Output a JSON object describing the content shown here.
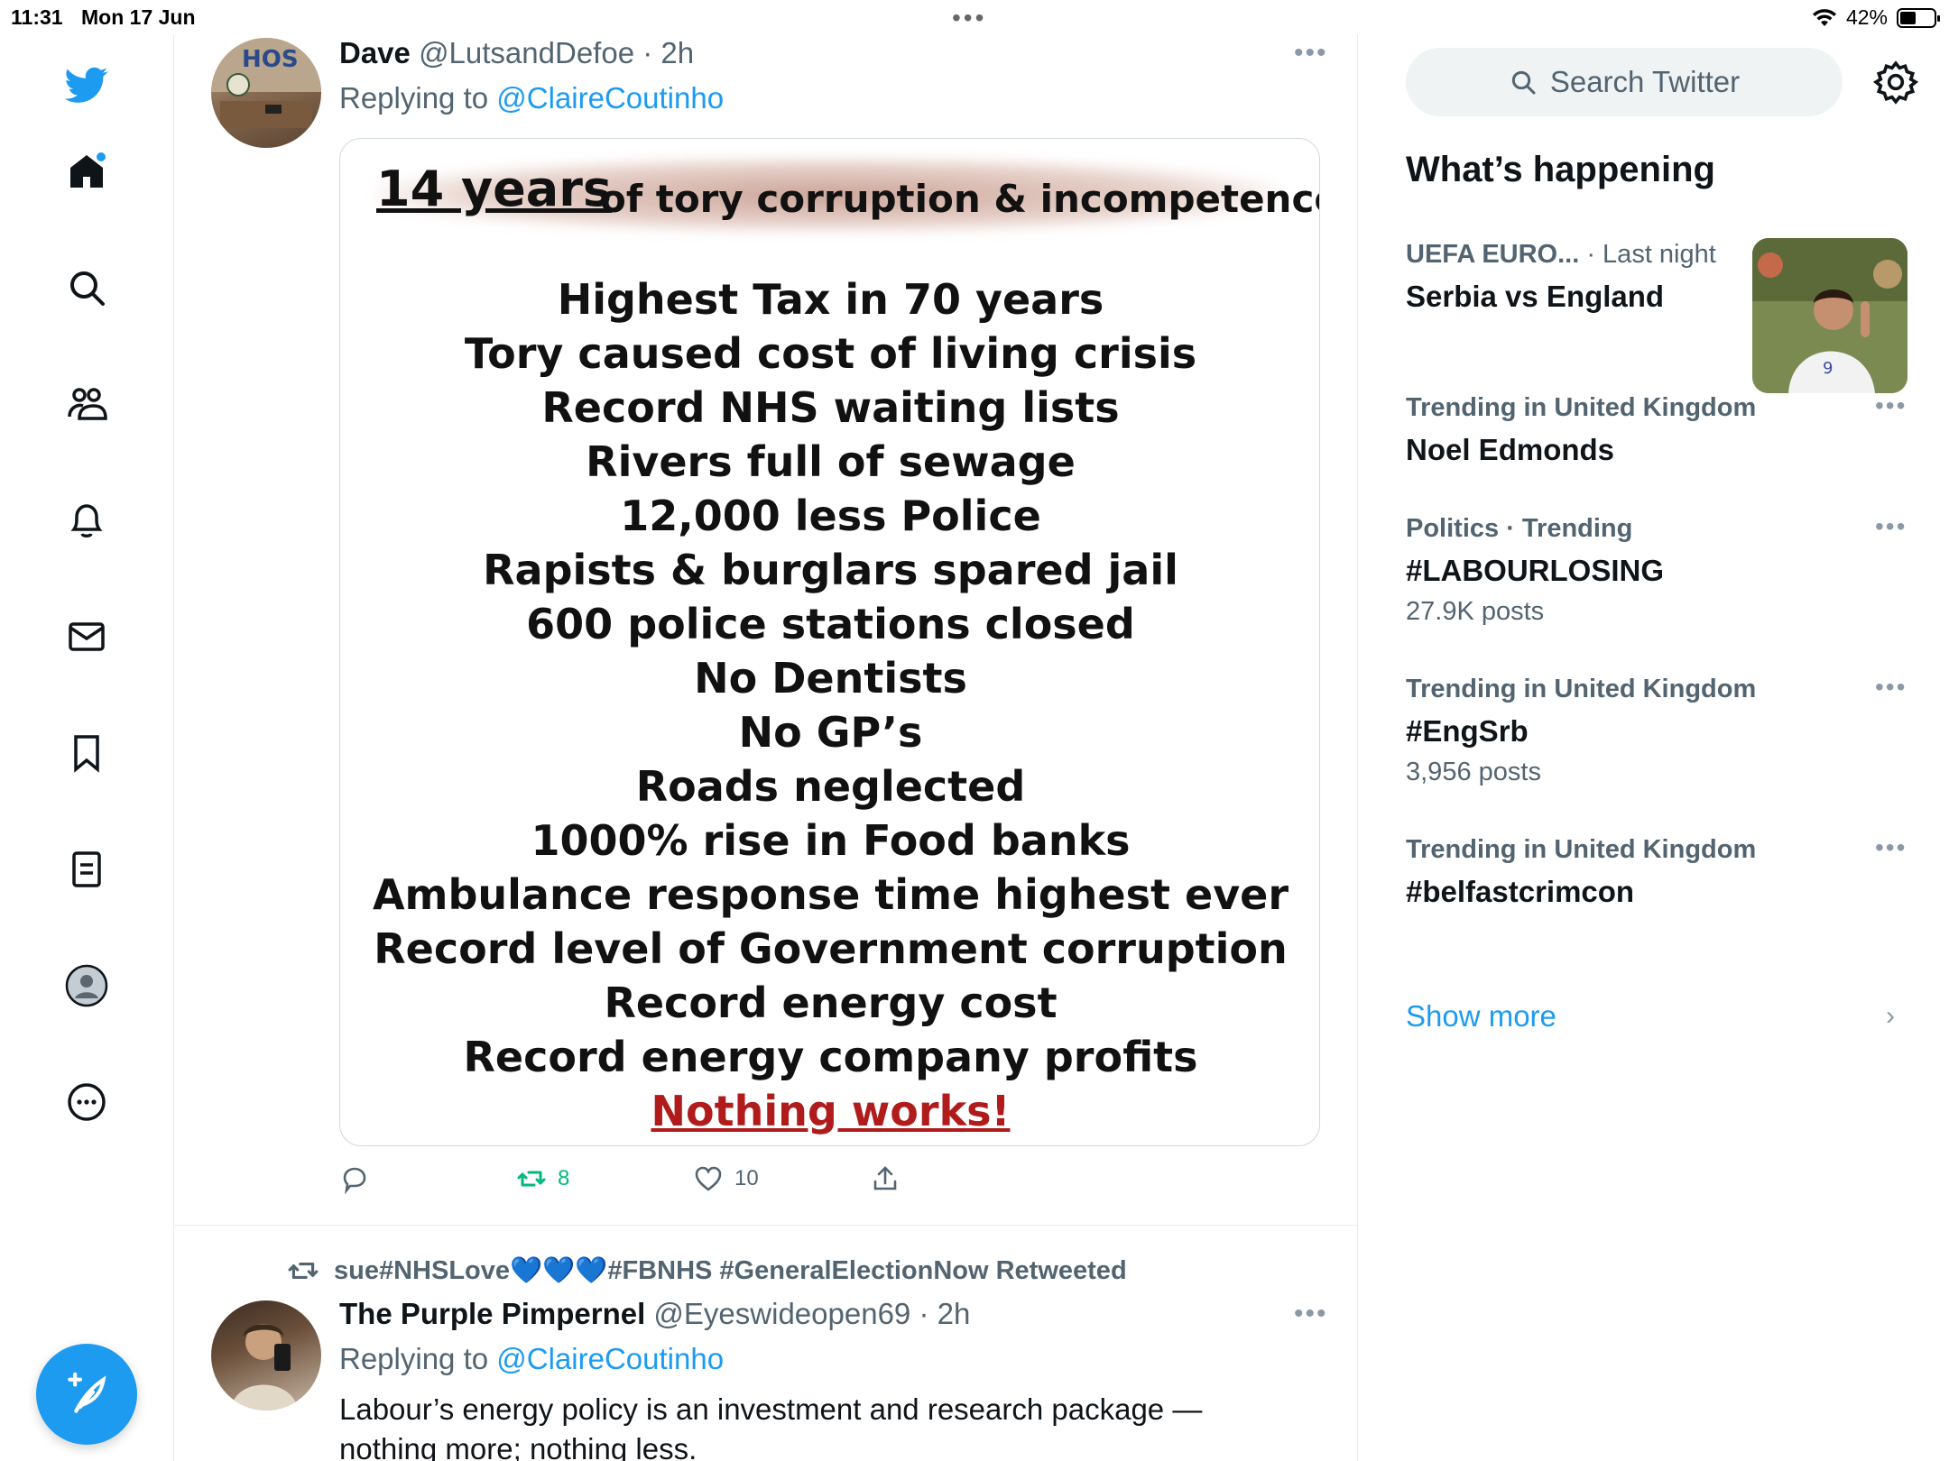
{
  "status_bar": {
    "time": "11:31",
    "date": "Mon 17 Jun",
    "battery": "42%",
    "battery_level": 0.42
  },
  "nav": {
    "items": [
      "twitter-logo",
      "home",
      "explore",
      "communities",
      "notifications",
      "messages",
      "bookmarks",
      "lists",
      "profile",
      "more"
    ],
    "compose_label": "Tweet"
  },
  "tweet1": {
    "name": "Dave",
    "handle": "@LutsandDefoe",
    "time": "· 2h",
    "replying_prefix": "Replying to",
    "replying_to": "@ClaireCoutinho",
    "image": {
      "title_big": "14 years",
      "title_small": "of tory corruption & incompetence",
      "lines": [
        "Highest Tax in 70 years",
        "Tory caused cost of living crisis",
        "Record NHS  waiting lists",
        "Rivers full of sewage",
        "12,000 less Police",
        "Rapists & burglars spared jail",
        "600 police stations closed",
        "No Dentists",
        "No GP’s",
        "Roads  neglected",
        "1000% rise in Food banks",
        "Ambulance response time highest ever",
        "Record level of Government corruption",
        "Record energy cost",
        "Record energy company profits"
      ],
      "last_line": "Nothing works!"
    },
    "retweets": "8",
    "likes": "10"
  },
  "tweet2": {
    "retweeted_by": "sue#NHSLove💙💙💙#FBNHS #GeneralElectionNow Retweeted",
    "name": "The Purple Pimpernel",
    "handle": "@Eyeswideopen69",
    "time": "· 2h",
    "replying_prefix": "Replying to",
    "replying_to": "@ClaireCoutinho",
    "text": "Labour’s energy policy is an investment and research package — nothing more; nothing less."
  },
  "sidebar": {
    "search_placeholder": "Search Twitter",
    "heading": "What’s happening",
    "featured": {
      "context": "UEFA EURO...",
      "time": "· Last night",
      "title": "Serbia vs England"
    },
    "trends": [
      {
        "context": "Trending in United Kingdom",
        "title": "Noel Edmonds",
        "count": ""
      },
      {
        "context": "Politics · Trending",
        "title": "#LABOURLOSING",
        "count": "27.9K posts"
      },
      {
        "context": "Trending in United Kingdom",
        "title": "#EngSrb",
        "count": "3,956 posts"
      },
      {
        "context": "Trending in United Kingdom",
        "title": "#belfastcrimcon",
        "count": ""
      }
    ],
    "show_more": "Show more"
  },
  "colors": {
    "accent": "#1d9bf0",
    "retweet_green": "#00ba7c",
    "secondary_text": "#536471",
    "highlight_red": "#b01c1c"
  }
}
